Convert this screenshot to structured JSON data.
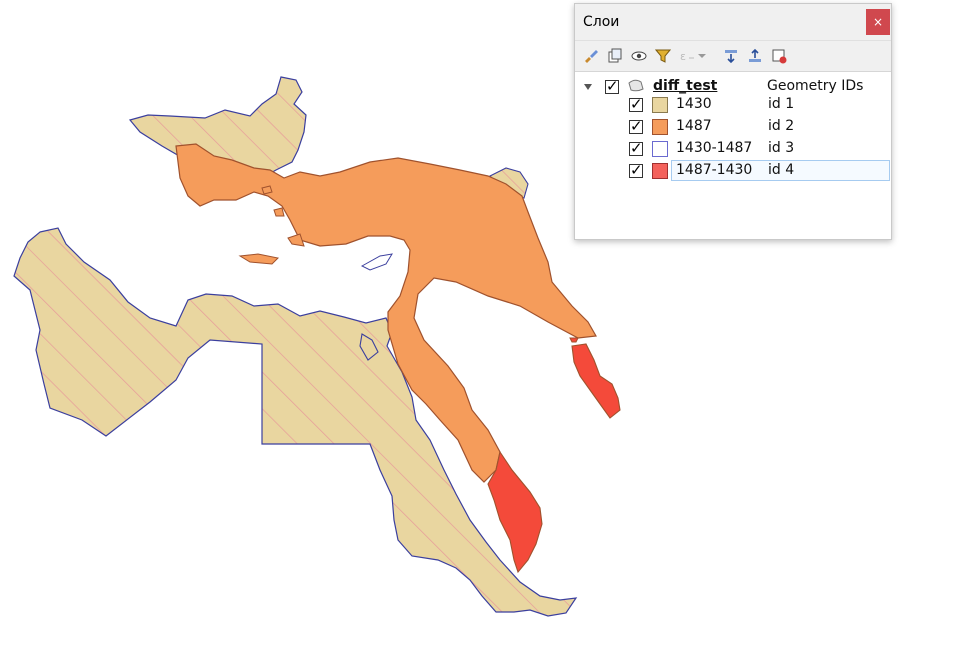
{
  "panel": {
    "title": "Слои",
    "close_label": "×",
    "toolbar_icons": [
      "style-brush-icon",
      "add-group-icon",
      "visibility-eye-icon",
      "filter-icon",
      "filter-expression-icon",
      "expand-all-icon",
      "collapse-all-icon",
      "remove-layer-icon"
    ]
  },
  "layer": {
    "name": "diff_test",
    "renderer": "Geometry IDs",
    "checked": true
  },
  "categories": [
    {
      "label": "1430",
      "value": "id  1",
      "color": "#e9d6a0",
      "checked": true
    },
    {
      "label": "1487",
      "value": "id 2",
      "color": "#f59c5b",
      "checked": true
    },
    {
      "label": "1430-1487",
      "value": "id 3",
      "color": "#ffffff",
      "checked": true
    },
    {
      "label": "1487-1430",
      "value": "id 4",
      "color": "#f4625c",
      "checked": true
    }
  ],
  "colors": {
    "stroke_1430": "#3b3f9e",
    "hatch": "#e89a9a",
    "stroke_1487": "#a0522d",
    "fill_1487_1430": "#f44a3a"
  }
}
